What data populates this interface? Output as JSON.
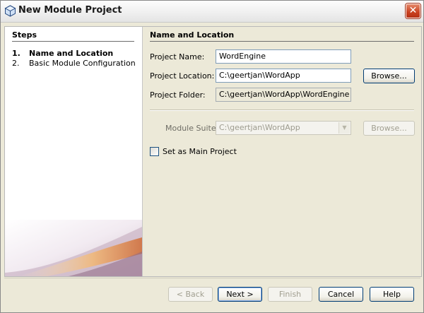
{
  "window": {
    "title": "New Module Project",
    "close_glyph": "✕"
  },
  "steps": {
    "heading": "Steps",
    "items": [
      {
        "number": "1.",
        "label": "Name and Location",
        "current": true
      },
      {
        "number": "2.",
        "label": "Basic Module Configuration",
        "current": false
      }
    ]
  },
  "content": {
    "heading": "Name and Location",
    "project_name": {
      "label": "Project Name:",
      "value": "WordEngine"
    },
    "project_location": {
      "label": "Project Location:",
      "value": "C:\\geertjan\\WordApp",
      "browse": "Browse..."
    },
    "project_folder": {
      "label": "Project Folder:",
      "value": "C:\\geertjan\\WordApp\\WordEngine"
    },
    "module_suite": {
      "label": "Module Suite:",
      "value": "C:\\geertjan\\WordApp",
      "browse": "Browse...",
      "enabled": false
    },
    "main_project": {
      "label": "Set as Main Project",
      "checked": false
    }
  },
  "footer": {
    "back": "< Back",
    "next": "Next >",
    "finish": "Finish",
    "cancel": "Cancel",
    "help": "Help"
  },
  "colors": {
    "close_button": "#c9401f",
    "field_border": "#7f9db9",
    "button_border": "#003c74",
    "dialog_background": "#ece9d8"
  },
  "icons": {
    "title": "netbeans-cube-icon",
    "close": "close-icon",
    "combo": "chevron-down-icon"
  }
}
